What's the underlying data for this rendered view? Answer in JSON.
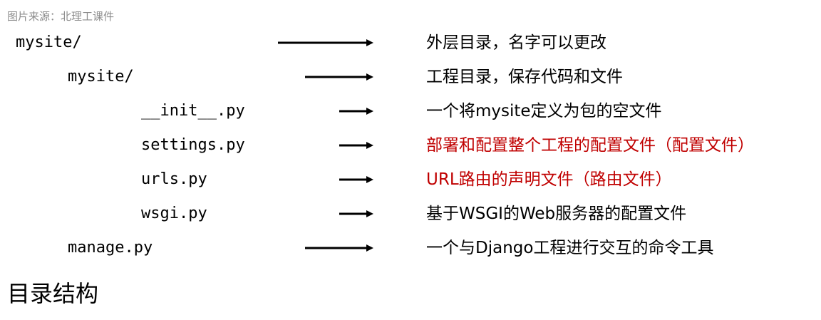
{
  "source_note": "图片来源：北理工课件",
  "rows": [
    {
      "file": "mysite/",
      "desc": "外层目录，名字可以更改",
      "highlight": false
    },
    {
      "file": "mysite/",
      "desc": "工程目录，保存代码和文件",
      "highlight": false
    },
    {
      "file": "__init__.py",
      "desc": "一个将mysite定义为包的空文件",
      "highlight": false
    },
    {
      "file": "settings.py",
      "desc": "部署和配置整个工程的配置文件（配置文件）",
      "highlight": true
    },
    {
      "file": "urls.py",
      "desc": "URL路由的声明文件（路由文件）",
      "highlight": true
    },
    {
      "file": "wsgi.py",
      "desc": "基于WSGI的Web服务器的配置文件",
      "highlight": false
    },
    {
      "file": "manage.py",
      "desc": "一个与Django工程进行交互的命令工具",
      "highlight": false
    }
  ],
  "caption": "目录结构",
  "colors": {
    "highlight": "#c00000",
    "text": "#000000",
    "source_note": "#8c8c8c"
  }
}
